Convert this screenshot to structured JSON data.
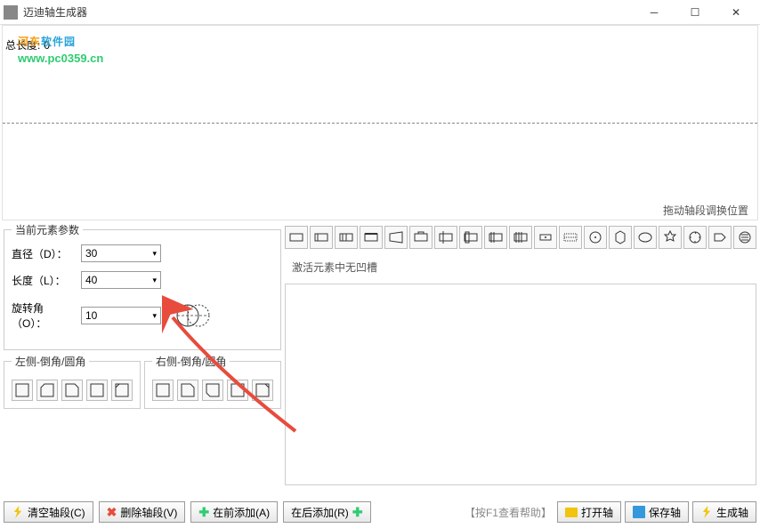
{
  "window": {
    "title": "迈迪轴生成器"
  },
  "watermark": {
    "part1": "河东",
    "part2": "软件园",
    "url": "www.pc0359.cn"
  },
  "total_length": {
    "label": "总长度:",
    "value": "0"
  },
  "drag_hint": "拖动轴段调换位置",
  "params": {
    "legend": "当前元素参数",
    "diameter": {
      "label": "直径（D）：",
      "value": "30"
    },
    "length": {
      "label": "长度（L）：",
      "value": "40"
    },
    "rotation": {
      "label": "旋转角（O）：",
      "value": "10"
    }
  },
  "chamfer": {
    "left_legend": "左侧-倒角/圆角",
    "right_legend": "右侧-倒角/圆角"
  },
  "slot_hint": "激活元素中无凹槽",
  "footer": {
    "clear": "清空轴段(C)",
    "delete": "删除轴段(V)",
    "add_before": "在前添加(A)",
    "add_after": "在后添加(R)",
    "help": "【按F1查看帮助】",
    "open": "打开轴",
    "save": "保存轴",
    "generate": "生成轴"
  }
}
